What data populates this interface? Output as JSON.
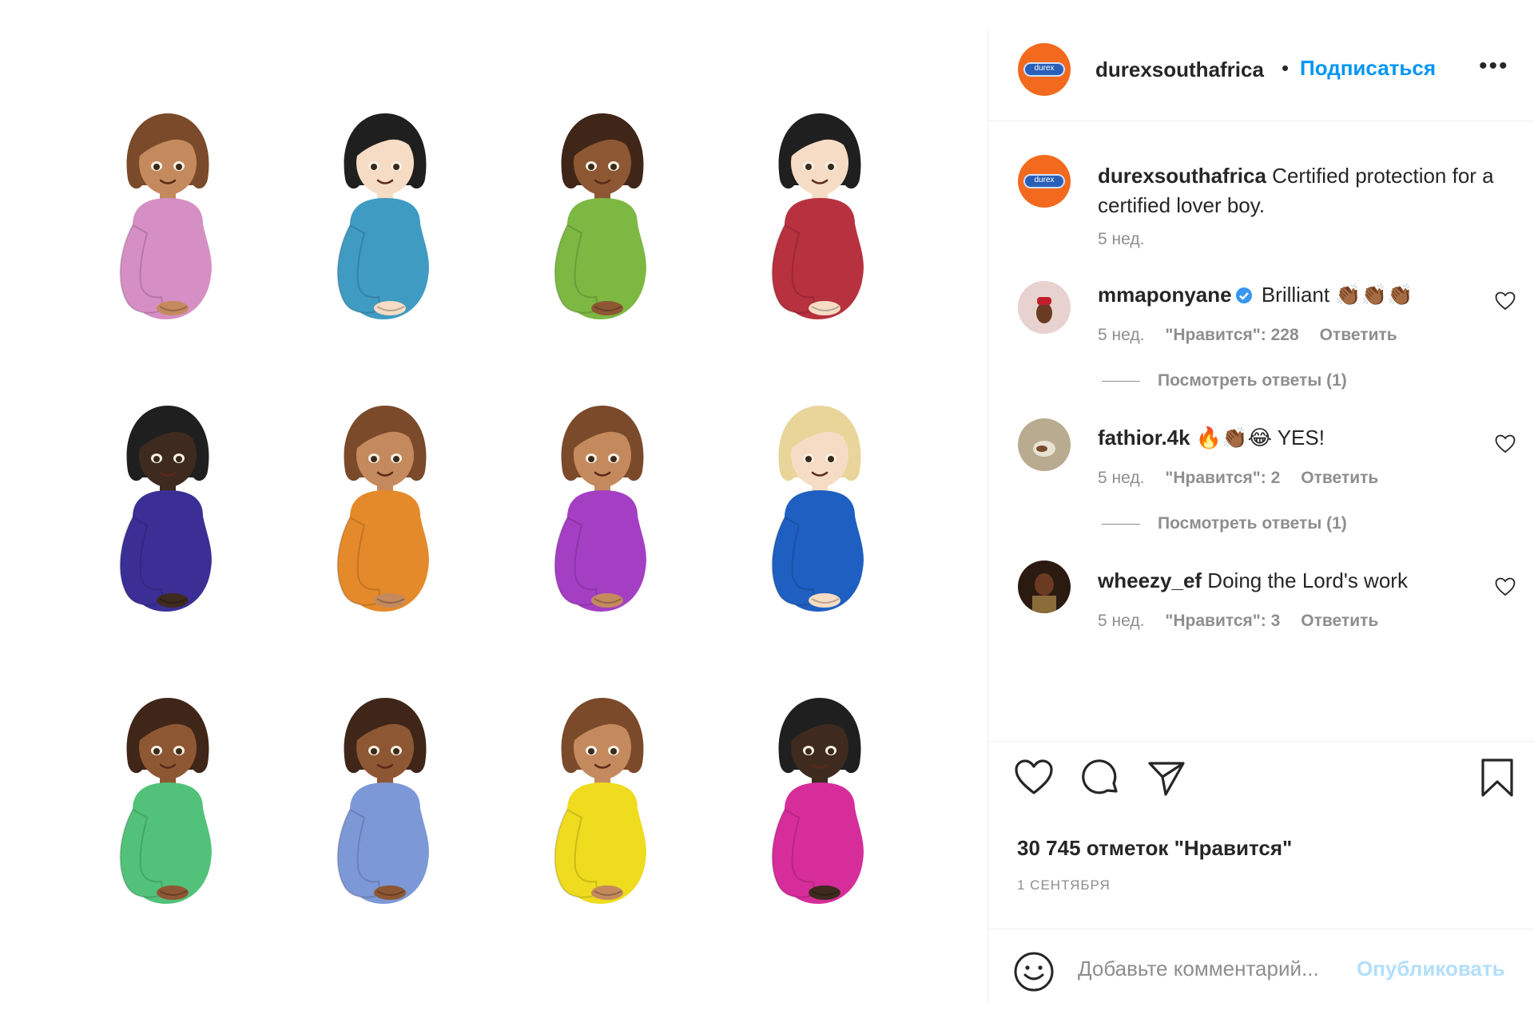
{
  "post": {
    "username": "durexsouthafrica",
    "separator": "•",
    "follow_label": "Подписаться",
    "more_label": "•••",
    "avatar_text": "durex",
    "caption_user": "durexsouthafrica",
    "caption_text": " Certified protection for a certified lover boy.",
    "caption_time": "5 нед.",
    "likes_total": "30 745 отметок \"Нравится\"",
    "date": "1 СЕНТЯБРЯ",
    "comment_placeholder": "Добавьте комментарий...",
    "post_label": "Опубликовать"
  },
  "comments": [
    {
      "user": "mmaponyane",
      "text": " Brilliant 👏🏾👏🏾👏🏾",
      "verified": true,
      "time": "5 нед.",
      "likes": "\"Нравится\": 228",
      "reply": "Ответить",
      "view_replies": "Посмотреть ответы (1)"
    },
    {
      "user": "fathior.4k",
      "text": " 🔥👏🏾😂 YES!",
      "verified": false,
      "time": "5 нед.",
      "likes": "\"Нравится\": 2",
      "reply": "Ответить",
      "view_replies": "Посмотреть ответы (1)"
    },
    {
      "user": "wheezy_ef",
      "text": " Doing the Lord's work",
      "verified": false,
      "time": "5 нед.",
      "likes": "\"Нравится\": 3",
      "reply": "Ответить"
    }
  ],
  "emojis": [
    {
      "shirt": "#d58fc4",
      "skin": "#c48a5e",
      "hair": "#7a4a2a"
    },
    {
      "shirt": "#3f9bc2",
      "skin": "#f6dcc4",
      "hair": "#1f1f1f"
    },
    {
      "shirt": "#7db843",
      "skin": "#8e5733",
      "hair": "#3f2618"
    },
    {
      "shirt": "#b8313f",
      "skin": "#f6dcc4",
      "hair": "#1f1f1f"
    },
    {
      "shirt": "#3b2f96",
      "skin": "#3e2a1f",
      "hair": "#1f1f1f"
    },
    {
      "shirt": "#e48a2b",
      "skin": "#c48a5e",
      "hair": "#7a4a2a"
    },
    {
      "shirt": "#a43fc4",
      "skin": "#c48a5e",
      "hair": "#7a4a2a"
    },
    {
      "shirt": "#1f5fc2",
      "skin": "#f6dcc4",
      "hair": "#e9d49a"
    },
    {
      "shirt": "#52c27a",
      "skin": "#8e5733",
      "hair": "#3f2618"
    },
    {
      "shirt": "#7d98d6",
      "skin": "#8e5733",
      "hair": "#3f2618"
    },
    {
      "shirt": "#efdc1f",
      "skin": "#c48a5e",
      "hair": "#7a4a2a"
    },
    {
      "shirt": "#d62d9a",
      "skin": "#3e2a1f",
      "hair": "#1f1f1f"
    }
  ]
}
